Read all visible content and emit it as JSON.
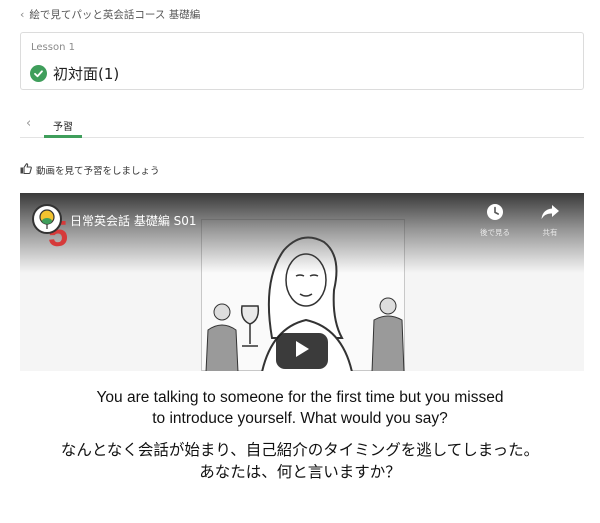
{
  "breadcrumb": {
    "chevron": "‹",
    "label": "絵で見てパッと英会話コース 基礎編"
  },
  "lesson": {
    "number_label": "Lesson 1",
    "title": "初対面(1)",
    "status_icon": "check-circle-icon",
    "status_color": "#3f9e5b"
  },
  "tabs": {
    "back_chevron": "‹",
    "items": [
      {
        "label": "予習",
        "active": true
      }
    ]
  },
  "instruction": {
    "icon": "thumbs-up-icon",
    "text": "動画を見て予習をしましょう"
  },
  "video": {
    "channel_number": "5",
    "title": "日常英会話 基礎編 S01",
    "actions": [
      {
        "icon": "clock-icon",
        "label": "後で見る"
      },
      {
        "icon": "share-icon",
        "label": "共有"
      }
    ],
    "play_icon": "play-icon"
  },
  "question": {
    "english": "You are talking to someone for the first time but you missed\nto introduce yourself.  What would you say?",
    "japanese": "なんとなく会話が始まり、自己紹介のタイミングを逃してしまった。\nあなたは、何と言いますか？"
  },
  "colors": {
    "accent": "#3f9e5b",
    "channel_number": "#d63a3a"
  }
}
